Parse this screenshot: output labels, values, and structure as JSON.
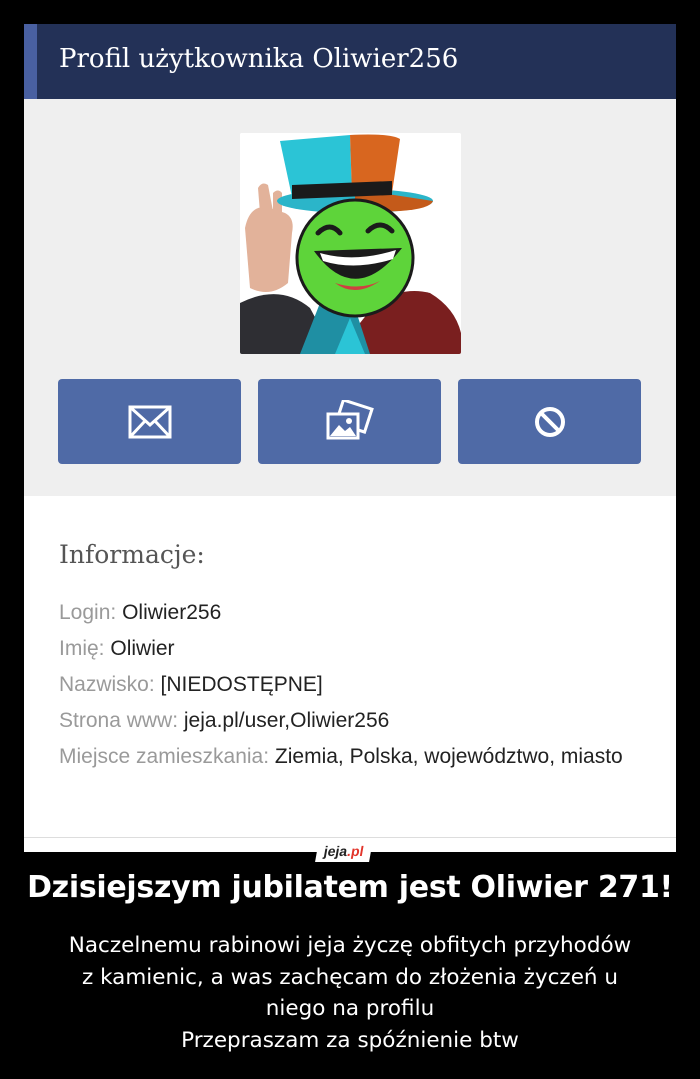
{
  "profile": {
    "title": "Profil użytkownika Oliwier256"
  },
  "actions": [
    {
      "icon": "envelope-icon"
    },
    {
      "icon": "gallery-icon"
    },
    {
      "icon": "block-icon"
    }
  ],
  "info": {
    "heading": "Informacje:",
    "rows": [
      {
        "label": "Login:",
        "value": "Oliwier256"
      },
      {
        "label": "Imię:",
        "value": "Oliwier"
      },
      {
        "label": "Nazwisko:",
        "value": "[NIEDOSTĘPNE]"
      },
      {
        "label": "Strona www:",
        "value": "jeja.pl/user,Oliwier256"
      },
      {
        "label": "Miejsce zamieszkania:",
        "value": "Ziemia, Polska, województwo, miasto"
      }
    ]
  },
  "logo": {
    "part1": "jeja",
    "part2": ".pl"
  },
  "caption": {
    "title": "Dzisiejszym jubilatem jest Oliwier 271!",
    "lines": [
      "Naczelnemu rabinowi jeja życzę obfitych przyhodów",
      "z kamienic, a was zachęcam do złożenia życzeń u",
      "niego na profilu",
      "Przepraszam za spóźnienie btw"
    ]
  },
  "colors": {
    "header_bg": "#233157",
    "accent": "#4960a1",
    "button_bg": "#4f6aa6",
    "page_bg": "#000000"
  }
}
